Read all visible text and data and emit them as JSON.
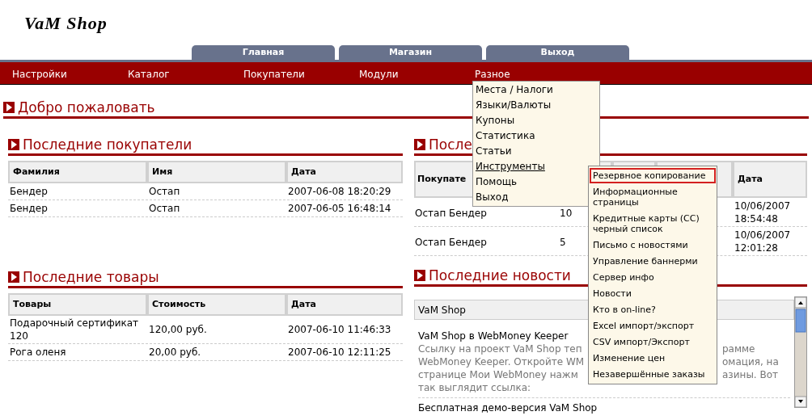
{
  "logo": "VaM Shop",
  "tabs": [
    "Главная",
    "Магазин",
    "Выход"
  ],
  "menu_bar": [
    "Настройки",
    "Каталог",
    "Покупатели",
    "Модули",
    "Разное"
  ],
  "welcome": "Добро пожаловать",
  "customers": {
    "title": "Последние покупатели",
    "columns": [
      "Фамилия",
      "Имя",
      "Дата"
    ],
    "rows": [
      [
        "Бендер",
        "Остап",
        "2007-06-08 18:20:29"
      ],
      [
        "Бендер",
        "Остап",
        "2007-06-05 16:48:14"
      ]
    ]
  },
  "products": {
    "title": "Последние товары",
    "columns": [
      "Товары",
      "Стоимость",
      "Дата"
    ],
    "rows": [
      [
        "Подарочный сертификат 120",
        "120,00 руб.",
        "2007-06-10 11:46:33"
      ],
      [
        "Рога оленя",
        "20,00 руб.",
        "2007-06-10 12:11:25"
      ]
    ]
  },
  "orders": {
    "title": "После",
    "column_1": "Покупате",
    "date_column": "Дата",
    "rows": [
      {
        "customer": "Остап Бендер",
        "column_2": "10",
        "date": "10/06/2007 18:54:48"
      },
      {
        "customer": "Остап Бендер",
        "column_2": "5",
        "date": "10/06/2007 12:01:28"
      }
    ]
  },
  "news": {
    "title": "Последние новости",
    "source": "VaM Shop",
    "items": [
      {
        "title": "VaM Shop в WebMoney Keeper",
        "lines": [
          {
            "left": "Ссылку на проект VaM Shop теп",
            "right": "рамме"
          },
          {
            "left": "WebMoney Keeper. Откройте WM",
            "right": "омация, на"
          },
          {
            "left": "странице Мои WebMoney нажм",
            "right": "азины. Вот"
          },
          {
            "left": "так выглядит ссылка:"
          }
        ]
      },
      {
        "title": "Бесплатная демо-версия VaM Shop"
      }
    ]
  },
  "dropdown": {
    "items": [
      {
        "label": "Места / Налоги",
        "selected": false
      },
      {
        "label": "Языки/Валюты",
        "selected": false
      },
      {
        "label": "Купоны",
        "selected": false
      },
      {
        "label": "Статистика",
        "selected": false
      },
      {
        "label": "Статьи",
        "selected": false
      },
      {
        "label": "Инструменты",
        "selected": true
      },
      {
        "label": "Помощь",
        "selected": false
      },
      {
        "label": "Выход",
        "selected": false
      }
    ]
  },
  "submenu": {
    "items": [
      {
        "label": "Резервное копирование",
        "selected": true
      },
      {
        "label": "Информационные страницы",
        "selected": false
      },
      {
        "label": "Кредитные карты (CC) черный список",
        "selected": false
      },
      {
        "label": "Письмо с новостями",
        "selected": false
      },
      {
        "label": "Управление баннерми",
        "selected": false
      },
      {
        "label": "Сервер инфо",
        "selected": false
      },
      {
        "label": "Новости",
        "selected": false
      },
      {
        "label": "Кто в on-line?",
        "selected": false
      },
      {
        "label": "Excel импорт/экспорт",
        "selected": false
      },
      {
        "label": "CSV импорт/Экспорт",
        "selected": false
      },
      {
        "label": "Изменение цен",
        "selected": false
      },
      {
        "label": "Незавершённые заказы",
        "selected": false
      }
    ]
  }
}
